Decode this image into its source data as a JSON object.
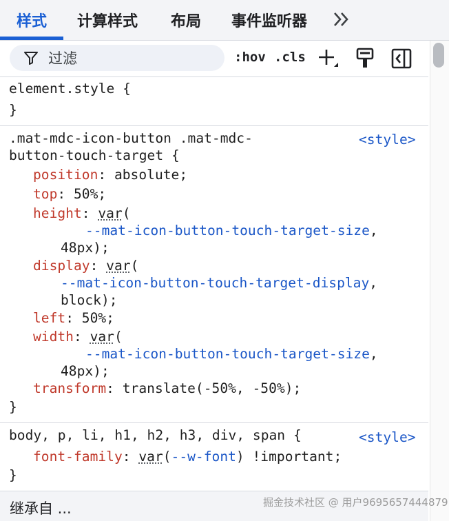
{
  "tabs": [
    {
      "label": "样式",
      "active": true
    },
    {
      "label": "计算样式",
      "active": false
    },
    {
      "label": "布局",
      "active": false
    },
    {
      "label": "事件监听器",
      "active": false
    }
  ],
  "more_tabs_icon": "double-chevron-right-icon",
  "toolbar": {
    "filter_placeholder": "过滤",
    "filter_icon": "filter-icon",
    "hov_label": ":hov",
    "cls_label": ".cls",
    "new_rule_icon": "plus-icon",
    "paint_icon": "paint-roller-icon",
    "sidebar_icon": "sidebar-toggle-icon"
  },
  "rules": {
    "element_style": {
      "selector": "element.style {",
      "close": "}"
    },
    "touch_target": {
      "selector_line1": ".mat-mdc-icon-button .mat-mdc-",
      "selector_line2": "button-touch-target {",
      "source": "<style>",
      "decls": {
        "position": {
          "prop": "position",
          "value": "absolute;"
        },
        "top": {
          "prop": "top",
          "value": "50%;"
        },
        "height": {
          "prop": "height",
          "fn": "var",
          "open": "(",
          "var": "--mat-icon-button-touch-target-size",
          "comma": ",",
          "fallback": "48px);"
        },
        "display": {
          "prop": "display",
          "fn": "var",
          "open": "(",
          "var": "--mat-icon-button-touch-target-display",
          "comma": ",",
          "fallback": "block);"
        },
        "left": {
          "prop": "left",
          "value": "50%;"
        },
        "width": {
          "prop": "width",
          "fn": "var",
          "open": "(",
          "var": "--mat-icon-button-touch-target-size",
          "comma": ",",
          "fallback": "48px);"
        },
        "transform": {
          "prop": "transform",
          "value": "translate(-50%, -50%);"
        }
      },
      "close": "}"
    },
    "body_rule": {
      "selector": "body, p, li, h1, h2, h3, div, span {",
      "source": "<style>",
      "decl": {
        "prop": "font-family",
        "fn": "var",
        "open": "(",
        "var": "--w-font",
        "rest": ") !important;"
      },
      "close": "}"
    }
  },
  "inherited_label": "继承自 ...",
  "watermark": "掘金技术社区 @ 用户9695657444879",
  "colors": {
    "accent": "#1a5fd4",
    "property": "#c0392b",
    "variable": "#1a56c7"
  }
}
